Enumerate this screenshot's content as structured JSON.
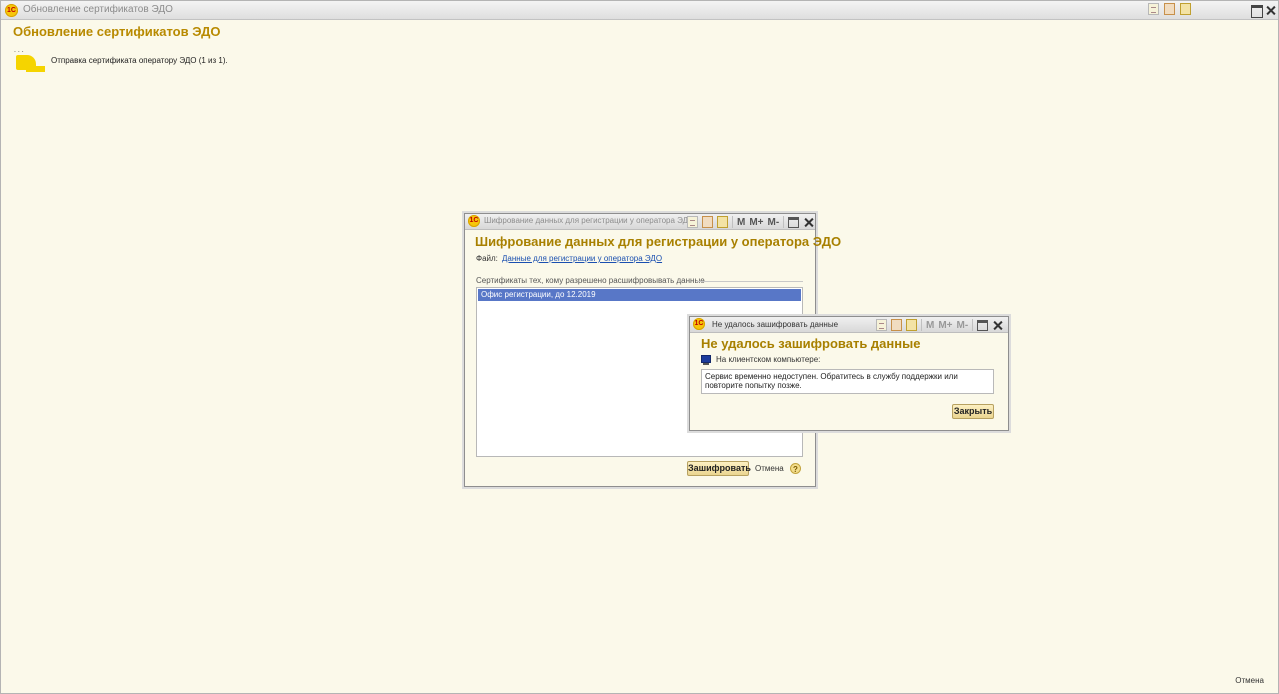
{
  "main_window": {
    "title": "Обновление сертификатов ЭДО",
    "logo": "1С",
    "heading": "Обновление сертификатов ЭДО",
    "status": "Отправка сертификата оператору ЭДО (1 из 1).",
    "cancel_label": "Отмена",
    "animation_dots": ". .  .",
    "animation_icon": "progress-animation-icon"
  },
  "encrypt_dialog": {
    "title": "Шифрование данных для регистрации у оператора ЭД...",
    "heading": "Шифрование данных для регистрации у оператора ЭДО",
    "file_label": "Файл:",
    "file_link": "Данные для регистрации у оператора ЭДО",
    "certs_label": "Сертификаты тех, кому разрешено расшифровывать данные",
    "certificates": [
      "Офис регистрации, до 12.2019"
    ],
    "encrypt_button": "Зашифровать",
    "cancel_button": "Отмена",
    "help_label": "?",
    "toolbar": {
      "m": "M",
      "m_plus": "M+",
      "m_minus": "M-"
    }
  },
  "error_dialog": {
    "title": "Не удалось зашифровать данные",
    "heading": "Не удалось зашифровать данные",
    "location": "На клиентском компьютере:",
    "message": "Сервис временно недоступен. Обратитесь в службу поддержки или повторите попытку позже.",
    "close_button": "Закрыть",
    "toolbar": {
      "m": "M",
      "m_plus": "M+",
      "m_minus": "M-"
    }
  },
  "colors": {
    "background": "#fbf9ea",
    "heading": "#b88a00",
    "selection": "#5877c7",
    "link": "#1a4fb0"
  }
}
